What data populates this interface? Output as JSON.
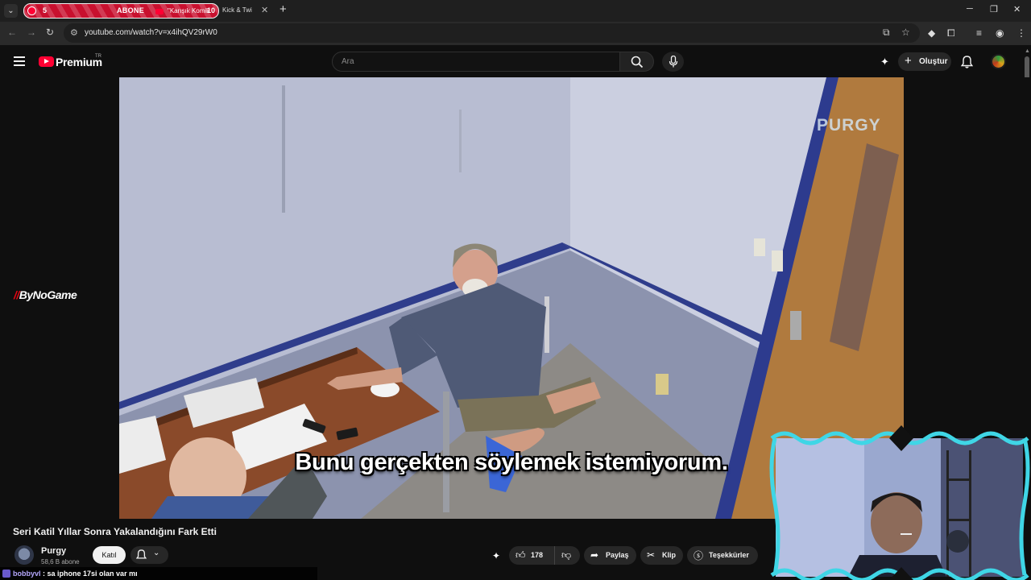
{
  "browser": {
    "active_tab": {
      "number": "5",
      "label": "ABONE",
      "title": "\"Karışık Komik",
      "count": "10"
    },
    "second_tab": {
      "title": "Kick & Twi"
    },
    "url": "youtube.com/watch?v=x4ihQV29rW0"
  },
  "youtube": {
    "brand": "Premium",
    "region": "TR",
    "search_placeholder": "Ara",
    "create_label": "Oluştur"
  },
  "video": {
    "subtitle": "Bunu gerçekten söylemek istemiyorum.",
    "watermark": "PURGY",
    "side_logo_mark": "//",
    "side_logo_text": "ByNoGame",
    "title": "Seri Katil Yıllar Sonra Yakalandığını Fark Etti"
  },
  "channel": {
    "name": "Purgy",
    "subs": "58,6 B abone",
    "join_label": "Katıl"
  },
  "actions": {
    "likes": "178",
    "share": "Paylaş",
    "clip": "Klip",
    "thanks": "Teşekkürler"
  },
  "chat": {
    "user": "bobbyvl",
    "message": ": sa iphone 17si olan var mı"
  },
  "colors": {
    "accent": "#ff0033",
    "tab_active": "#c8102e",
    "cam_frame": "#3fd6e6"
  }
}
